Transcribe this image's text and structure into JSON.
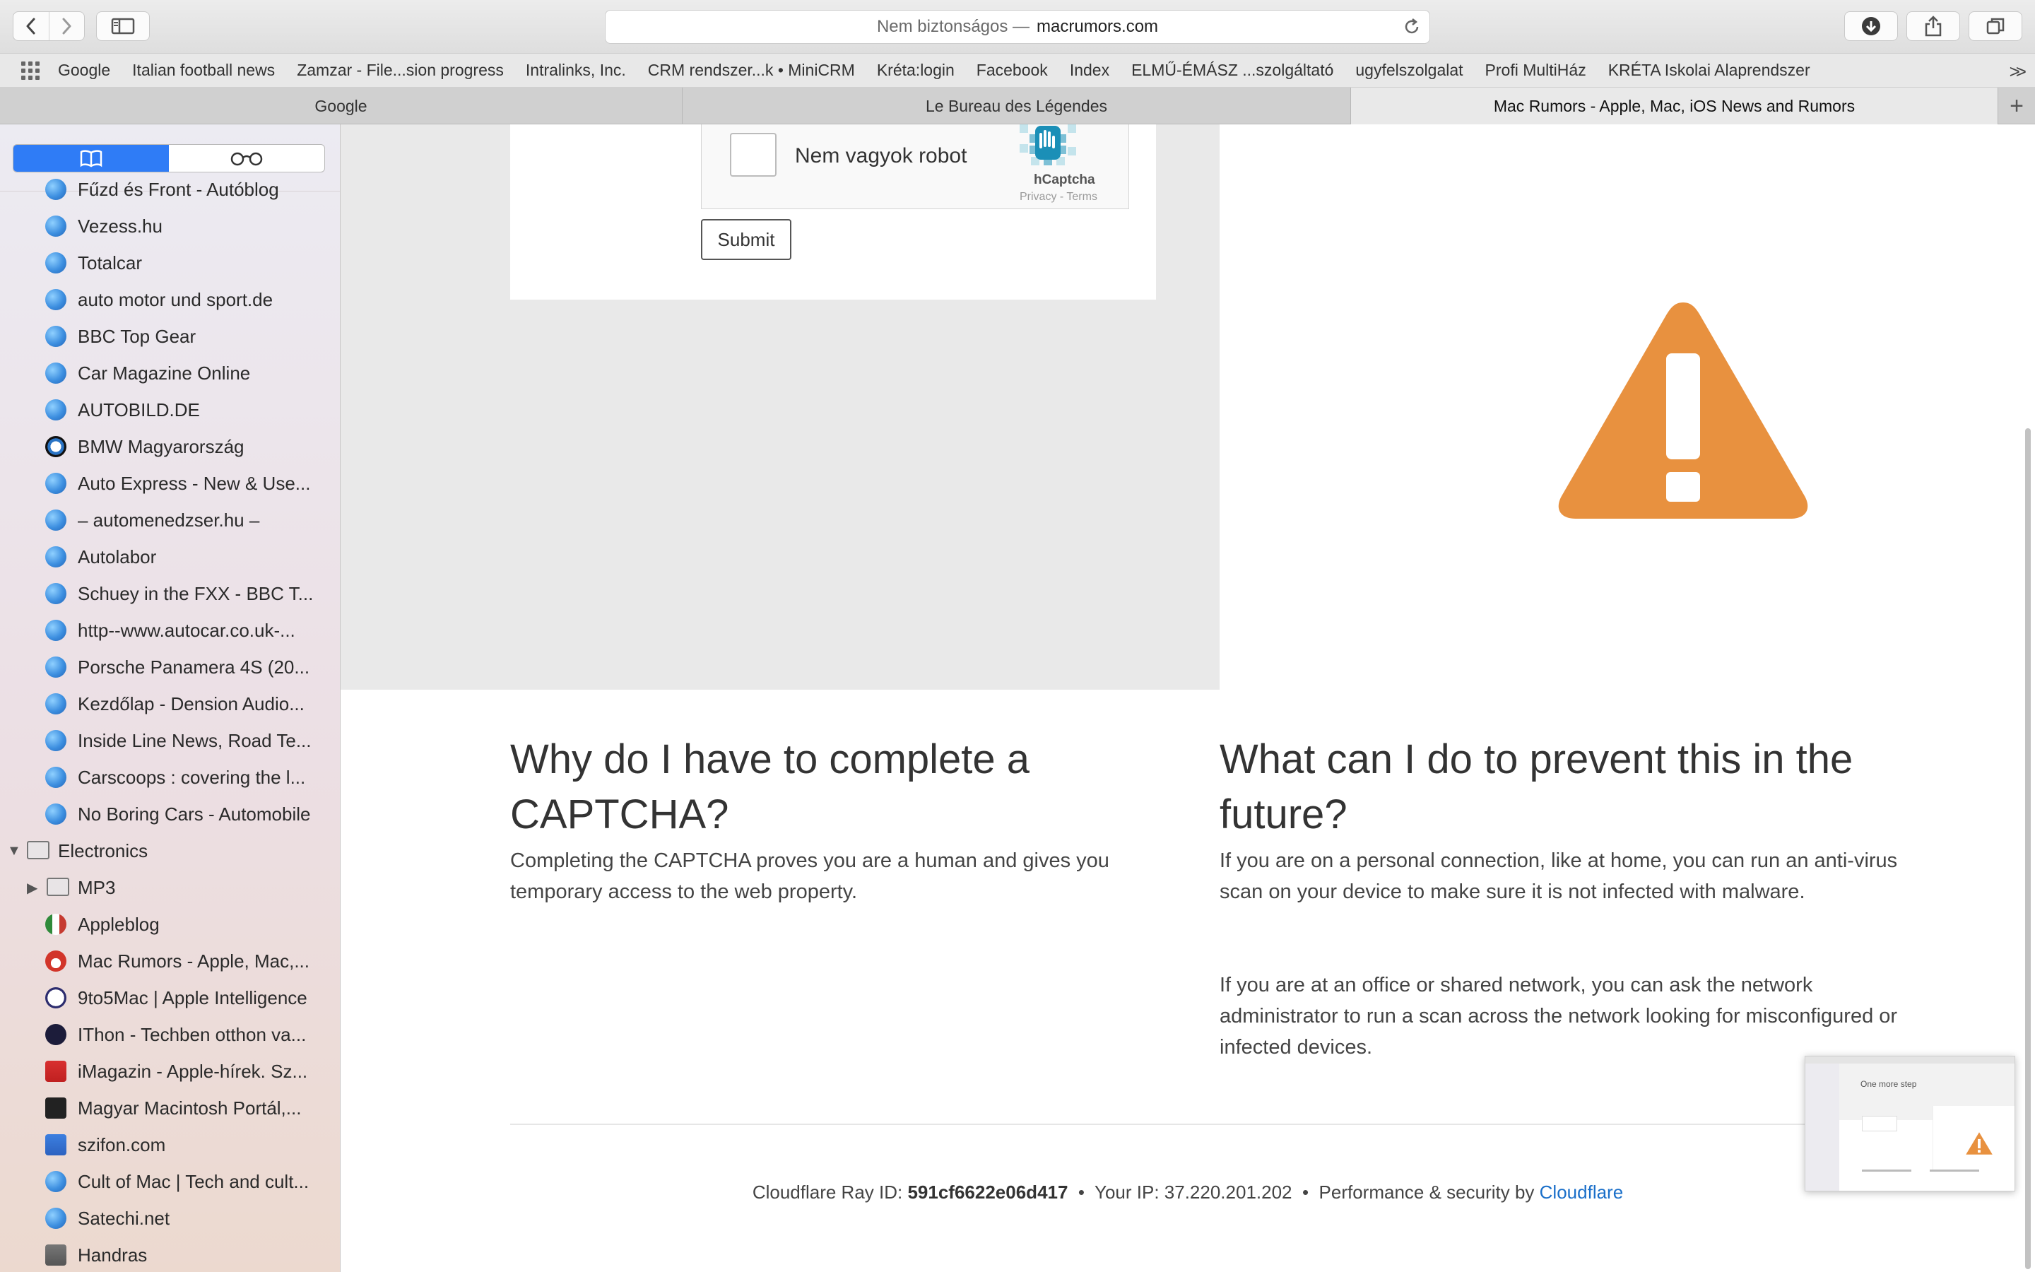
{
  "toolbar": {
    "address_prefix": "Nem biztonságos —",
    "address_host": "macrumors.com"
  },
  "bookmarks": [
    "Google",
    "Italian football news",
    "Zamzar - File...sion progress",
    "Intralinks, Inc.",
    "CRM rendszer...k • MiniCRM",
    "Kréta:login",
    "Facebook",
    "Index",
    "ELMŰ-ÉMÁSZ ...szolgáltató",
    "ugyfelszolgalat",
    "Profi MultiHáz",
    "KRÉTA Iskolai Alaprendszer"
  ],
  "tabs": [
    "Google",
    "Le Bureau des Légendes",
    "Mac Rumors - Apple, Mac, iOS News and Rumors"
  ],
  "sidebar": {
    "items": [
      {
        "label": "Fűzd és Front - Autóblog",
        "type": "site",
        "icon": "globe-icon"
      },
      {
        "label": "Vezess.hu",
        "type": "site",
        "icon": "globe-icon"
      },
      {
        "label": "Totalcar",
        "type": "site",
        "icon": "globe-icon"
      },
      {
        "label": "auto motor und sport.de",
        "type": "site",
        "icon": "globe-icon"
      },
      {
        "label": "BBC Top Gear",
        "type": "site",
        "icon": "globe-icon"
      },
      {
        "label": "Car Magazine Online",
        "type": "site",
        "icon": "globe-icon"
      },
      {
        "label": "AUTOBILD.DE",
        "type": "site",
        "icon": "globe-icon"
      },
      {
        "label": "BMW Magyarország",
        "type": "site",
        "icon": "bmw-icon"
      },
      {
        "label": "Auto Express - New & Use...",
        "type": "site",
        "icon": "globe-icon"
      },
      {
        "label": "– automenedzser.hu –",
        "type": "site",
        "icon": "globe-icon"
      },
      {
        "label": "Autolabor",
        "type": "site",
        "icon": "globe-icon"
      },
      {
        "label": "Schuey in the FXX - BBC T...",
        "type": "site",
        "icon": "globe-icon"
      },
      {
        "label": "http--www.autocar.co.uk-...",
        "type": "site",
        "icon": "globe-icon"
      },
      {
        "label": "Porsche Panamera 4S (20...",
        "type": "site",
        "icon": "globe-icon"
      },
      {
        "label": "Kezdőlap - Dension Audio...",
        "type": "site",
        "icon": "globe-icon"
      },
      {
        "label": "Inside Line News, Road Te...",
        "type": "site",
        "icon": "globe-icon"
      },
      {
        "label": "Carscoops : covering the l...",
        "type": "site",
        "icon": "globe-icon"
      },
      {
        "label": "No Boring Cars - Automobile",
        "type": "site",
        "icon": "globe-icon"
      },
      {
        "label": "Electronics",
        "type": "folder-open",
        "icon": "folder-icon"
      },
      {
        "label": "MP3",
        "type": "folder-closed",
        "icon": "folder-icon"
      },
      {
        "label": "Appleblog",
        "type": "site",
        "icon": "appleblog-icon"
      },
      {
        "label": "Mac Rumors - Apple, Mac,...",
        "type": "site",
        "icon": "macrumors-icon"
      },
      {
        "label": "9to5Mac | Apple Intelligence",
        "type": "site",
        "icon": "clock-icon"
      },
      {
        "label": "IThon - Techben otthon va...",
        "type": "site",
        "icon": "ithon-icon"
      },
      {
        "label": "iMagazin - Apple-hírek. Sz...",
        "type": "site",
        "icon": "imagazin-icon"
      },
      {
        "label": "Magyar Macintosh Portál,...",
        "type": "site",
        "icon": "bm-icon"
      },
      {
        "label": "szifon.com",
        "type": "site",
        "icon": "szifon-icon"
      },
      {
        "label": "Cult of Mac | Tech and cult...",
        "type": "site",
        "icon": "globe-icon"
      },
      {
        "label": "Satechi.net",
        "type": "site",
        "icon": "globe-icon"
      },
      {
        "label": "Handras",
        "type": "site",
        "icon": "handras-icon"
      }
    ]
  },
  "captcha": {
    "label": "Nem vagyok robot",
    "brand": "hCaptcha",
    "links": "Privacy - Terms",
    "submit": "Submit"
  },
  "why": {
    "heading": "Why do I have to complete a CAPTCHA?",
    "body": "Completing the CAPTCHA proves you are a human and gives you temporary access to the web property."
  },
  "prevent": {
    "heading": "What can I do to prevent this in the future?",
    "body1": "If you are on a personal connection, like at home, you can run an anti-virus scan on your device to make sure it is not infected with malware.",
    "body2": "If you are at an office or shared network, you can ask the network administrator to run a scan across the network looking for misconfigured or infected devices."
  },
  "footer": {
    "ray_label": "Cloudflare Ray ID:",
    "ray_id": "591cf6622e06d417",
    "sep": "•",
    "ip_label": "Your IP:",
    "ip": "37.220.201.202",
    "perf_label": "Performance & security by",
    "link": "Cloudflare"
  },
  "thumbnail": {
    "title": "One more step"
  },
  "colors": {
    "warning": "#e8913f",
    "accent": "#2f7cf6",
    "link": "#1a6fc9"
  }
}
